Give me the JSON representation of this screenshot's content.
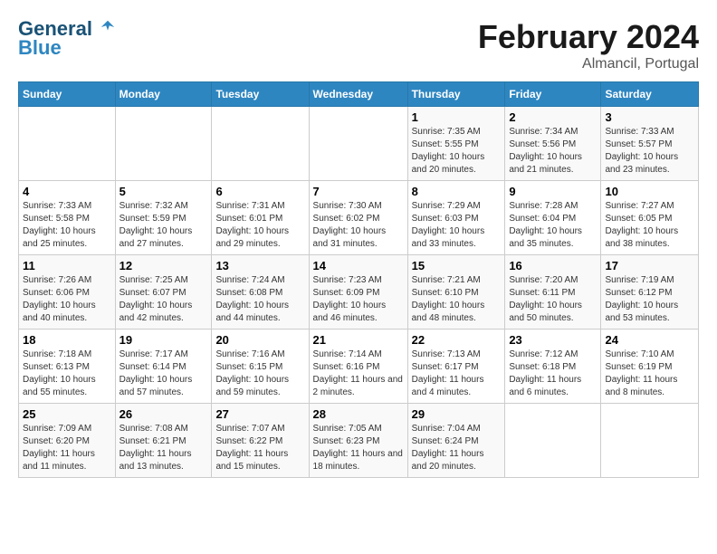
{
  "logo": {
    "line1": "General",
    "line2": "Blue"
  },
  "title": "February 2024",
  "subtitle": "Almancil, Portugal",
  "days_of_week": [
    "Sunday",
    "Monday",
    "Tuesday",
    "Wednesday",
    "Thursday",
    "Friday",
    "Saturday"
  ],
  "weeks": [
    [
      {
        "num": "",
        "info": ""
      },
      {
        "num": "",
        "info": ""
      },
      {
        "num": "",
        "info": ""
      },
      {
        "num": "",
        "info": ""
      },
      {
        "num": "1",
        "info": "Sunrise: 7:35 AM\nSunset: 5:55 PM\nDaylight: 10 hours and 20 minutes."
      },
      {
        "num": "2",
        "info": "Sunrise: 7:34 AM\nSunset: 5:56 PM\nDaylight: 10 hours and 21 minutes."
      },
      {
        "num": "3",
        "info": "Sunrise: 7:33 AM\nSunset: 5:57 PM\nDaylight: 10 hours and 23 minutes."
      }
    ],
    [
      {
        "num": "4",
        "info": "Sunrise: 7:33 AM\nSunset: 5:58 PM\nDaylight: 10 hours and 25 minutes."
      },
      {
        "num": "5",
        "info": "Sunrise: 7:32 AM\nSunset: 5:59 PM\nDaylight: 10 hours and 27 minutes."
      },
      {
        "num": "6",
        "info": "Sunrise: 7:31 AM\nSunset: 6:01 PM\nDaylight: 10 hours and 29 minutes."
      },
      {
        "num": "7",
        "info": "Sunrise: 7:30 AM\nSunset: 6:02 PM\nDaylight: 10 hours and 31 minutes."
      },
      {
        "num": "8",
        "info": "Sunrise: 7:29 AM\nSunset: 6:03 PM\nDaylight: 10 hours and 33 minutes."
      },
      {
        "num": "9",
        "info": "Sunrise: 7:28 AM\nSunset: 6:04 PM\nDaylight: 10 hours and 35 minutes."
      },
      {
        "num": "10",
        "info": "Sunrise: 7:27 AM\nSunset: 6:05 PM\nDaylight: 10 hours and 38 minutes."
      }
    ],
    [
      {
        "num": "11",
        "info": "Sunrise: 7:26 AM\nSunset: 6:06 PM\nDaylight: 10 hours and 40 minutes."
      },
      {
        "num": "12",
        "info": "Sunrise: 7:25 AM\nSunset: 6:07 PM\nDaylight: 10 hours and 42 minutes."
      },
      {
        "num": "13",
        "info": "Sunrise: 7:24 AM\nSunset: 6:08 PM\nDaylight: 10 hours and 44 minutes."
      },
      {
        "num": "14",
        "info": "Sunrise: 7:23 AM\nSunset: 6:09 PM\nDaylight: 10 hours and 46 minutes."
      },
      {
        "num": "15",
        "info": "Sunrise: 7:21 AM\nSunset: 6:10 PM\nDaylight: 10 hours and 48 minutes."
      },
      {
        "num": "16",
        "info": "Sunrise: 7:20 AM\nSunset: 6:11 PM\nDaylight: 10 hours and 50 minutes."
      },
      {
        "num": "17",
        "info": "Sunrise: 7:19 AM\nSunset: 6:12 PM\nDaylight: 10 hours and 53 minutes."
      }
    ],
    [
      {
        "num": "18",
        "info": "Sunrise: 7:18 AM\nSunset: 6:13 PM\nDaylight: 10 hours and 55 minutes."
      },
      {
        "num": "19",
        "info": "Sunrise: 7:17 AM\nSunset: 6:14 PM\nDaylight: 10 hours and 57 minutes."
      },
      {
        "num": "20",
        "info": "Sunrise: 7:16 AM\nSunset: 6:15 PM\nDaylight: 10 hours and 59 minutes."
      },
      {
        "num": "21",
        "info": "Sunrise: 7:14 AM\nSunset: 6:16 PM\nDaylight: 11 hours and 2 minutes."
      },
      {
        "num": "22",
        "info": "Sunrise: 7:13 AM\nSunset: 6:17 PM\nDaylight: 11 hours and 4 minutes."
      },
      {
        "num": "23",
        "info": "Sunrise: 7:12 AM\nSunset: 6:18 PM\nDaylight: 11 hours and 6 minutes."
      },
      {
        "num": "24",
        "info": "Sunrise: 7:10 AM\nSunset: 6:19 PM\nDaylight: 11 hours and 8 minutes."
      }
    ],
    [
      {
        "num": "25",
        "info": "Sunrise: 7:09 AM\nSunset: 6:20 PM\nDaylight: 11 hours and 11 minutes."
      },
      {
        "num": "26",
        "info": "Sunrise: 7:08 AM\nSunset: 6:21 PM\nDaylight: 11 hours and 13 minutes."
      },
      {
        "num": "27",
        "info": "Sunrise: 7:07 AM\nSunset: 6:22 PM\nDaylight: 11 hours and 15 minutes."
      },
      {
        "num": "28",
        "info": "Sunrise: 7:05 AM\nSunset: 6:23 PM\nDaylight: 11 hours and 18 minutes."
      },
      {
        "num": "29",
        "info": "Sunrise: 7:04 AM\nSunset: 6:24 PM\nDaylight: 11 hours and 20 minutes."
      },
      {
        "num": "",
        "info": ""
      },
      {
        "num": "",
        "info": ""
      }
    ]
  ]
}
